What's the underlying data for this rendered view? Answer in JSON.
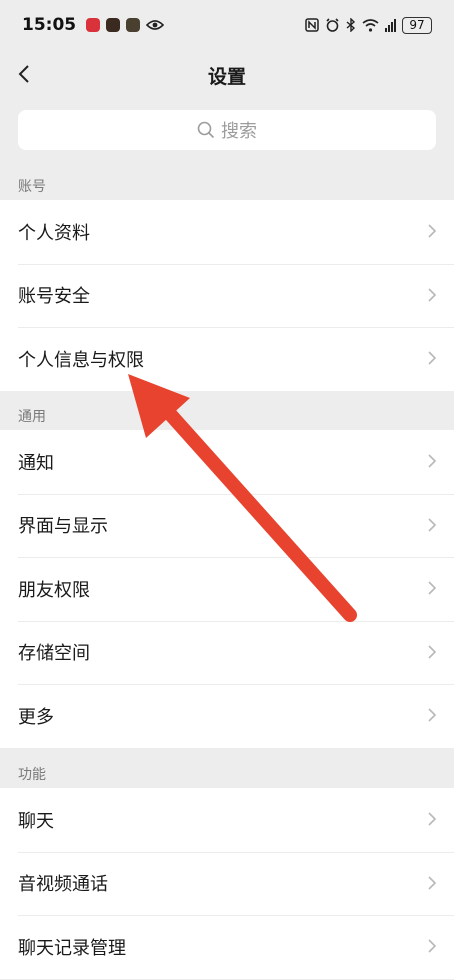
{
  "status_bar": {
    "time": "15:05",
    "battery": "97"
  },
  "nav": {
    "title": "设置"
  },
  "search": {
    "placeholder": "搜索"
  },
  "sections": [
    {
      "label": "账号",
      "items": [
        "个人资料",
        "账号安全",
        "个人信息与权限"
      ]
    },
    {
      "label": "通用",
      "items": [
        "通知",
        "界面与显示",
        "朋友权限",
        "存储空间",
        "更多"
      ]
    },
    {
      "label": "功能",
      "items": [
        "聊天",
        "音视频通话",
        "聊天记录管理"
      ]
    }
  ],
  "colors": {
    "background": "#ededed",
    "arrow": "#e8432f",
    "chevron": "#b8b8b8"
  }
}
